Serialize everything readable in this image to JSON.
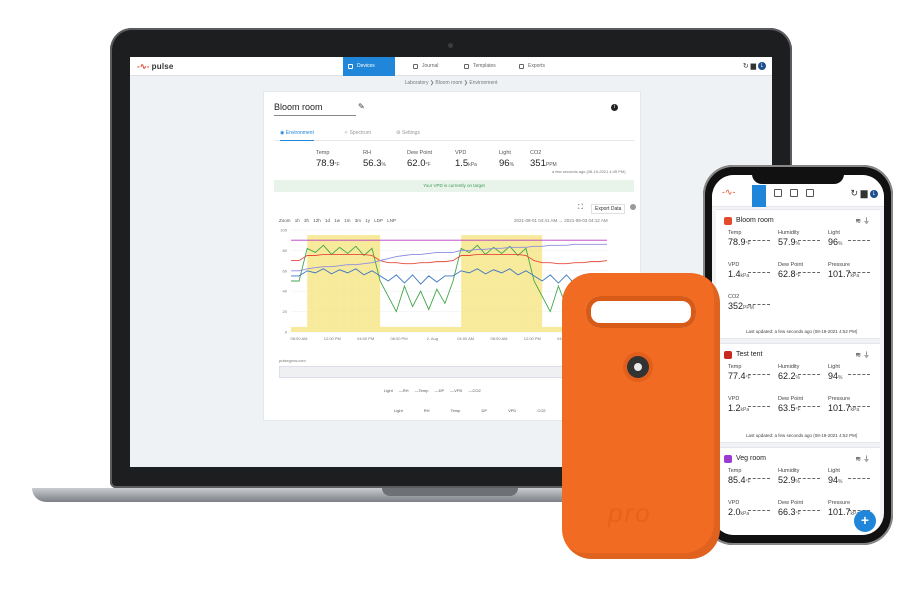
{
  "app": {
    "logo_text": "pulse",
    "brand_color": "#1f86d9",
    "accent_color": "#e24a2b"
  },
  "nav": {
    "tabs": [
      {
        "label": "Devices",
        "icon": "devices-icon",
        "active": true
      },
      {
        "label": "Journal",
        "icon": "journal-icon"
      },
      {
        "label": "Templates",
        "icon": "templates-icon"
      },
      {
        "label": "Exports",
        "icon": "exports-icon"
      }
    ],
    "user_initial": "L"
  },
  "breadcrumb": "Laboratory  ❯  Bloom room  ❯  Environment",
  "room": {
    "title": "Bloom room",
    "subtabs": [
      "Environment",
      "Spectrum",
      "Settings"
    ],
    "metrics": [
      {
        "label": "Temp",
        "value": "78.9",
        "unit": "°F"
      },
      {
        "label": "RH",
        "value": "56.3",
        "unit": "%"
      },
      {
        "label": "Dew Point",
        "value": "62.0",
        "unit": "°F"
      },
      {
        "label": "VPD",
        "value": "1.5",
        "unit": "kPa"
      },
      {
        "label": "Light",
        "value": "96",
        "unit": "%"
      },
      {
        "label": "CO2",
        "value": "351",
        "unit": "PPM"
      }
    ],
    "updated": "a few seconds ago (08-19-2021 4:45 PM)",
    "vpd_banner": "Your VPD is currently on target",
    "export_label": "Export Data",
    "zoom_label": "Zoom  1h  3h  12h  1d  1w  1m  3m  1y  LDP  LNP",
    "range_text": "2021-08-01 04:41 AM  →  2021-08-03 04:12 AM",
    "legend": "Light  —RH  —Temp  —DP  —VPD  —CO2",
    "bottom_labels": "Light  RH  Temp  DP  VPD  CO2",
    "site": "pulsegrow.com",
    "x_ticks": [
      "08:00 AM",
      "12:00 PM",
      "04:00 PM",
      "08:00 PM",
      "2. Aug",
      "04:00 AM",
      "08:00 AM",
      "12:00 PM",
      "04:00 PM",
      "08:00 PM"
    ],
    "y_ticks": [
      "100",
      "80",
      "60",
      "40",
      "20",
      "0"
    ]
  },
  "chart_data": {
    "type": "line",
    "x": [
      0,
      1,
      2,
      3,
      4,
      5,
      6,
      7,
      8,
      9,
      10,
      11,
      12,
      13,
      14,
      15,
      16,
      17,
      18,
      19,
      20,
      21,
      22,
      23,
      24,
      25,
      26,
      27,
      28,
      29,
      30,
      31,
      32,
      33,
      34,
      35,
      36,
      37,
      38,
      39
    ],
    "series": [
      {
        "name": "Light",
        "color": "#f5e37a",
        "values": [
          5,
          5,
          95,
          95,
          95,
          95,
          95,
          95,
          95,
          95,
          95,
          5,
          5,
          5,
          5,
          5,
          5,
          5,
          5,
          5,
          5,
          95,
          95,
          95,
          95,
          95,
          95,
          95,
          95,
          95,
          95,
          5,
          5,
          5,
          5,
          5,
          5,
          5,
          5,
          5
        ]
      },
      {
        "name": "RH",
        "color": "#43a64b",
        "values": [
          50,
          50,
          82,
          78,
          85,
          76,
          83,
          77,
          84,
          75,
          82,
          50,
          35,
          20,
          45,
          25,
          40,
          22,
          42,
          28,
          50,
          82,
          78,
          85,
          76,
          83,
          77,
          84,
          75,
          82,
          50,
          35,
          20,
          45,
          25,
          40,
          22,
          42,
          28,
          50
        ]
      },
      {
        "name": "Temp",
        "color": "#e64b3c",
        "values": [
          70,
          70,
          75,
          75,
          76,
          76,
          76,
          76,
          76,
          76,
          75,
          70,
          68,
          68,
          67,
          67,
          68,
          68,
          69,
          69,
          70,
          75,
          75,
          76,
          76,
          76,
          76,
          76,
          76,
          75,
          70,
          68,
          68,
          67,
          67,
          68,
          68,
          69,
          69,
          70
        ]
      },
      {
        "name": "DP",
        "color": "#3a76c2",
        "values": [
          55,
          55,
          60,
          58,
          62,
          57,
          61,
          58,
          62,
          56,
          60,
          55,
          50,
          56,
          48,
          56,
          47,
          55,
          49,
          55,
          55,
          60,
          58,
          62,
          57,
          61,
          58,
          62,
          56,
          60,
          55,
          50,
          56,
          48,
          56,
          47,
          55,
          49,
          55,
          55
        ]
      },
      {
        "name": "VPD",
        "color": "#8e8be0",
        "values": [
          60,
          60,
          62,
          63,
          64,
          64,
          65,
          66,
          66,
          67,
          68,
          70,
          72,
          74,
          75,
          76,
          76,
          77,
          78,
          78,
          78,
          80,
          80,
          81,
          81,
          82,
          82,
          83,
          83,
          83,
          84,
          84,
          85,
          85,
          85,
          86,
          86,
          86,
          86,
          86
        ]
      },
      {
        "name": "CO2",
        "color": "#b63bbd",
        "values": [
          90,
          90,
          90,
          90,
          90,
          90,
          90,
          90,
          90,
          90,
          90,
          90,
          90,
          90,
          90,
          90,
          90,
          90,
          90,
          90,
          90,
          90,
          90,
          90,
          90,
          90,
          90,
          90,
          90,
          90,
          90,
          90,
          90,
          90,
          90,
          90,
          90,
          90,
          90,
          90
        ]
      }
    ],
    "ylim": [
      0,
      100
    ],
    "grid": true,
    "legend_position": "bottom"
  },
  "phone": {
    "rooms": [
      {
        "name": "Bloom room",
        "icon_color": "#e24a2b",
        "metrics": [
          {
            "label": "Temp",
            "value": "78.9",
            "unit": "°F"
          },
          {
            "label": "Humidity",
            "value": "57.9",
            "unit": "%"
          },
          {
            "label": "Light",
            "value": "96",
            "unit": "%"
          },
          {
            "label": "VPD",
            "value": "1.4",
            "unit": "kPa"
          },
          {
            "label": "Dew Point",
            "value": "62.8",
            "unit": "°F"
          },
          {
            "label": "Pressure",
            "value": "101.7",
            "unit": "kPa"
          },
          {
            "label": "CO2",
            "value": "352",
            "unit": "PPM"
          }
        ],
        "updated": "Last updated: a few seconds ago (08-19-2021 4:52 PM)"
      },
      {
        "name": "Test tent",
        "icon_color": "#c92a1f",
        "metrics": [
          {
            "label": "Temp",
            "value": "77.4",
            "unit": "°F"
          },
          {
            "label": "Humidity",
            "value": "62.2",
            "unit": "%"
          },
          {
            "label": "Light",
            "value": "94",
            "unit": "%"
          },
          {
            "label": "VPD",
            "value": "1.2",
            "unit": "kPa"
          },
          {
            "label": "Dew Point",
            "value": "63.5",
            "unit": "°F"
          },
          {
            "label": "Pressure",
            "value": "101.7",
            "unit": "kPa"
          }
        ],
        "updated": "Last updated: a few seconds ago (08-19-2021 4:52 PM)"
      },
      {
        "name": "Veg room",
        "icon_color": "#9c3bd0",
        "metrics": [
          {
            "label": "Temp",
            "value": "85.4",
            "unit": "°F"
          },
          {
            "label": "Humidity",
            "value": "52.9",
            "unit": "%"
          },
          {
            "label": "Light",
            "value": "94",
            "unit": "%"
          },
          {
            "label": "VPD",
            "value": "2.0",
            "unit": "kPa"
          },
          {
            "label": "Dew Point",
            "value": "66.3",
            "unit": "°F"
          },
          {
            "label": "Pressure",
            "value": "101.7",
            "unit": "kPa"
          }
        ]
      }
    ],
    "fab_label": "+"
  },
  "device": {
    "label": "pro",
    "color": "#f26b22"
  }
}
